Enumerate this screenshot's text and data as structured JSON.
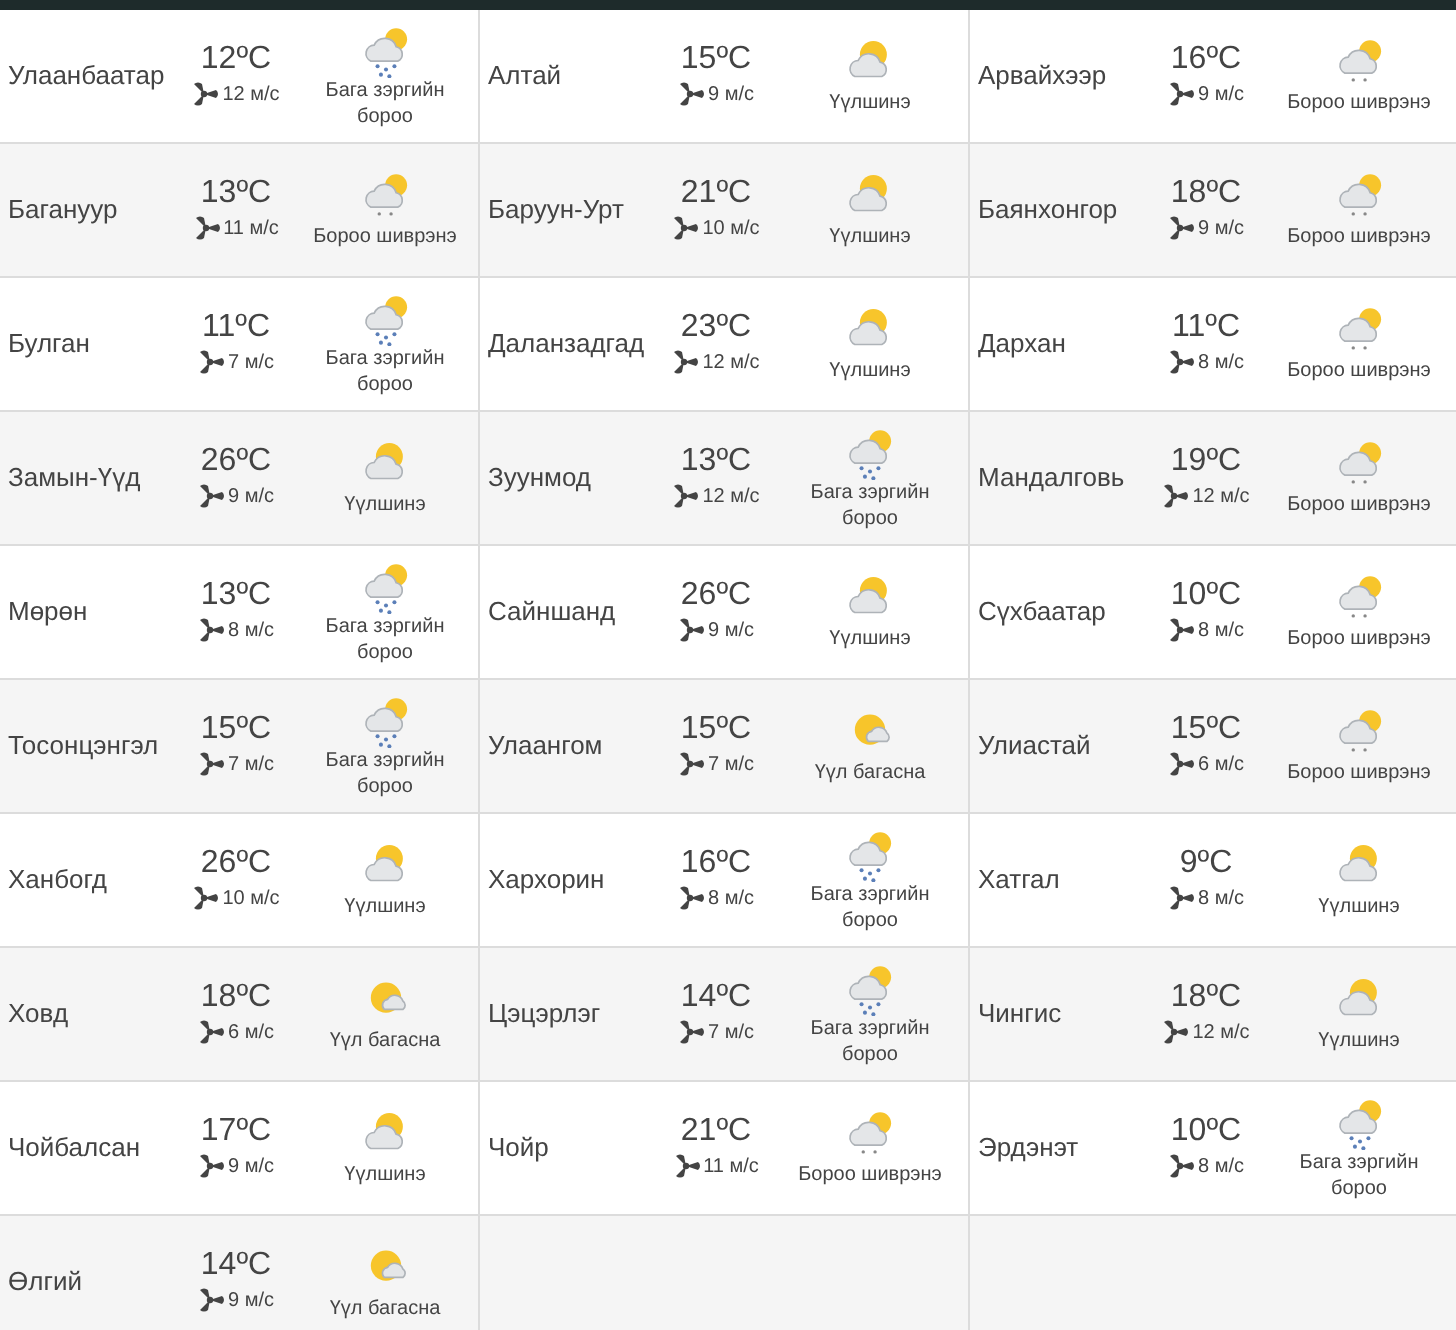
{
  "rows": [
    {
      "cells": [
        {
          "city": "Улаанбаатар",
          "temp": "12ºC",
          "wind": "12 м/с",
          "kind": "rain",
          "condition": "Бага зэргийн бороо"
        },
        {
          "city": "Алтай",
          "temp": "15ºC",
          "wind": "9 м/с",
          "kind": "cloudy",
          "condition": "Үүлшинэ"
        },
        {
          "city": "Арвайхээр",
          "temp": "16ºC",
          "wind": "9 м/с",
          "kind": "drizzle",
          "condition": "Бороо шиврэнэ"
        }
      ]
    },
    {
      "cells": [
        {
          "city": "Багануур",
          "temp": "13ºC",
          "wind": "11 м/с",
          "kind": "drizzle",
          "condition": "Бороо шиврэнэ"
        },
        {
          "city": "Баруун-Урт",
          "temp": "21ºC",
          "wind": "10 м/с",
          "kind": "cloudy",
          "condition": "Үүлшинэ"
        },
        {
          "city": "Баянхонгор",
          "temp": "18ºC",
          "wind": "9 м/с",
          "kind": "drizzle",
          "condition": "Бороо шиврэнэ"
        }
      ]
    },
    {
      "cells": [
        {
          "city": "Булган",
          "temp": "11ºC",
          "wind": "7 м/с",
          "kind": "rain",
          "condition": "Бага зэргийн бороо"
        },
        {
          "city": "Даланзадгад",
          "temp": "23ºC",
          "wind": "12 м/с",
          "kind": "cloudy",
          "condition": "Үүлшинэ"
        },
        {
          "city": "Дархан",
          "temp": "11ºC",
          "wind": "8 м/с",
          "kind": "drizzle",
          "condition": "Бороо шиврэнэ"
        }
      ]
    },
    {
      "cells": [
        {
          "city": "Замын-Үүд",
          "temp": "26ºC",
          "wind": "9 м/с",
          "kind": "cloudy",
          "condition": "Үүлшинэ"
        },
        {
          "city": "Зуунмод",
          "temp": "13ºC",
          "wind": "12 м/с",
          "kind": "rain",
          "condition": "Бага зэргийн бороо"
        },
        {
          "city": "Мандалговь",
          "temp": "19ºC",
          "wind": "12 м/с",
          "kind": "drizzle",
          "condition": "Бороо шиврэнэ"
        }
      ]
    },
    {
      "cells": [
        {
          "city": "Мөрөн",
          "temp": "13ºC",
          "wind": "8 м/с",
          "kind": "rain",
          "condition": "Бага зэргийн бороо"
        },
        {
          "city": "Сайншанд",
          "temp": "26ºC",
          "wind": "9 м/с",
          "kind": "cloudy",
          "condition": "Үүлшинэ"
        },
        {
          "city": "Сүхбаатар",
          "temp": "10ºC",
          "wind": "8 м/с",
          "kind": "drizzle",
          "condition": "Бороо шиврэнэ"
        }
      ]
    },
    {
      "cells": [
        {
          "city": "Тосонцэнгэл",
          "temp": "15ºC",
          "wind": "7 м/с",
          "kind": "rain",
          "condition": "Бага зэргийн бороо"
        },
        {
          "city": "Улаангом",
          "temp": "15ºC",
          "wind": "7 м/с",
          "kind": "sunny",
          "condition": "Үүл багасна"
        },
        {
          "city": "Улиастай",
          "temp": "15ºC",
          "wind": "6 м/с",
          "kind": "drizzle",
          "condition": "Бороо шиврэнэ"
        }
      ]
    },
    {
      "cells": [
        {
          "city": "Ханбогд",
          "temp": "26ºC",
          "wind": "10 м/с",
          "kind": "cloudy",
          "condition": "Үүлшинэ"
        },
        {
          "city": "Хархорин",
          "temp": "16ºC",
          "wind": "8 м/с",
          "kind": "rain",
          "condition": "Бага зэргийн бороо"
        },
        {
          "city": "Хатгал",
          "temp": "9ºC",
          "wind": "8 м/с",
          "kind": "cloudy",
          "condition": "Үүлшинэ"
        }
      ]
    },
    {
      "cells": [
        {
          "city": "Ховд",
          "temp": "18ºC",
          "wind": "6 м/с",
          "kind": "sunny",
          "condition": "Үүл багасна"
        },
        {
          "city": "Цэцэрлэг",
          "temp": "14ºC",
          "wind": "7 м/с",
          "kind": "rain",
          "condition": "Бага зэргийн бороо"
        },
        {
          "city": "Чингис",
          "temp": "18ºC",
          "wind": "12 м/с",
          "kind": "cloudy",
          "condition": "Үүлшинэ"
        }
      ]
    },
    {
      "cells": [
        {
          "city": "Чойбалсан",
          "temp": "17ºC",
          "wind": "9 м/с",
          "kind": "cloudy",
          "condition": "Үүлшинэ"
        },
        {
          "city": "Чойр",
          "temp": "21ºC",
          "wind": "11 м/с",
          "kind": "drizzle",
          "condition": "Бороо шиврэнэ"
        },
        {
          "city": "Эрдэнэт",
          "temp": "10ºC",
          "wind": "8 м/с",
          "kind": "rain",
          "condition": "Бага зэргийн бороо"
        }
      ]
    },
    {
      "cells": [
        {
          "city": "Өлгий",
          "temp": "14ºC",
          "wind": "9 м/с",
          "kind": "sunny",
          "condition": "Үүл багасна"
        }
      ]
    }
  ]
}
